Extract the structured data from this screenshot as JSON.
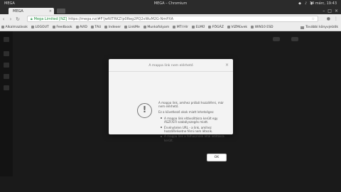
{
  "system_bar": {
    "window_title": "MEGA – Chromium",
    "tab_title": "MEGA",
    "clock": "14 márc, 19:43"
  },
  "toolbar": {
    "secure_label": "Mega Limited [NZ]",
    "url": "https://mega.nz/#F!JwNlTRKZ!p0Reg2PQ2vWuM2G-NmPXA"
  },
  "bookmarks": {
    "items": [
      "Alkalmazások",
      "LOGOUT",
      "Feedbook",
      "AVID",
      "TAU",
      "Indexer",
      "LinkMe",
      "Munkafolyam",
      "MTI Hír",
      "ELMŰ",
      "FŐGÁZ",
      "VIZMüvek",
      "WIN10 ESD"
    ],
    "more_label": "További könyvjelzők"
  },
  "dialog": {
    "title": "A mappa link nem elérhető",
    "intro": "A mappa link, amihez próbál hozzáférni, már nem elérhető.",
    "reasons_lead": "Ez a következő okok miatt lehetséges:",
    "reasons": [
      "A mappa link eltávolításra került egy ÁSZF/EFI szabályszegés miatt.",
      "Érvénytelen URL - a link, amihez hozzáférésetne férni nem létezik.",
      "A mappa link a felhasználó által letiltásra került."
    ],
    "ok_label": "OK"
  }
}
